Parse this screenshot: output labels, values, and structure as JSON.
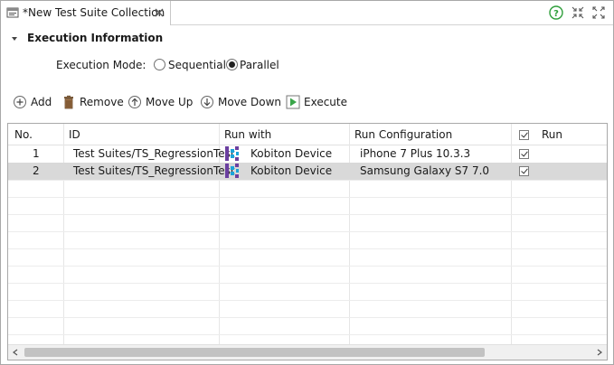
{
  "tab": {
    "title": "*New Test Suite Collection"
  },
  "section": {
    "title": "Execution Information"
  },
  "execution_mode": {
    "label": "Execution Mode:",
    "options": [
      "Sequential",
      "Parallel"
    ],
    "selected": "Parallel"
  },
  "toolbar": {
    "add_label": "Add",
    "remove_label": "Remove",
    "move_up_label": "Move Up",
    "move_down_label": "Move Down",
    "execute_label": "Execute"
  },
  "table": {
    "columns": {
      "no": "No.",
      "id": "ID",
      "run_with": "Run with",
      "run_configuration": "Run Configuration",
      "run": "Run"
    },
    "rows": [
      {
        "no": "1",
        "id": "Test Suites/TS_RegressionTest",
        "run_with": "Kobiton Device",
        "run_configuration": "iPhone 7 Plus 10.3.3",
        "run": true,
        "selected": false
      },
      {
        "no": "2",
        "id": "Test Suites/TS_RegressionTest",
        "run_with": "Kobiton Device",
        "run_configuration": "Samsung Galaxy S7 7.0",
        "run": true,
        "selected": true
      }
    ]
  },
  "icons": {
    "tab": "test-suite-collection-icon",
    "close": "close-icon",
    "help": "help-icon",
    "minimize": "minimize-icon",
    "maximize": "maximize-icon",
    "section_toggle": "triangle-down-icon",
    "add": "add-icon",
    "remove": "trash-icon",
    "move_up": "arrow-up-icon",
    "move_down": "arrow-down-icon",
    "execute": "play-icon",
    "kobiton": "kobiton-icon",
    "run_all": "checkbox-icon"
  },
  "colors": {
    "help_green": "#2e9e3a",
    "execute_green": "#3aa64a",
    "kobiton_purple": "#6b3fa0",
    "kobiton_blue": "#1aa3d9",
    "selected_row": "#d9d9d9"
  }
}
